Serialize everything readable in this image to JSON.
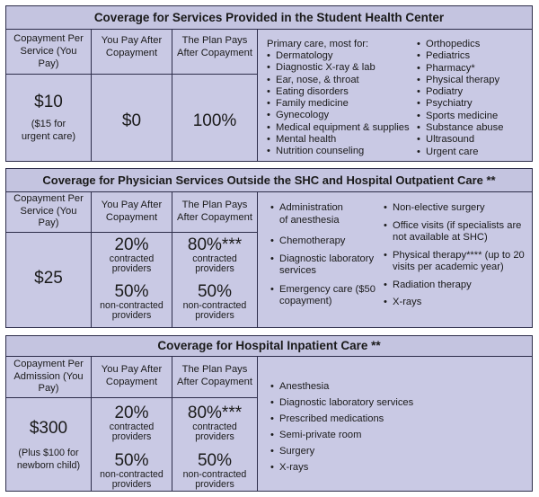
{
  "shc": {
    "title": "Coverage for Services Provided in the Student Health Center",
    "headers": [
      "Copayment Per Service (You Pay)",
      "You Pay After Copayment",
      "The Plan Pays After Copayment"
    ],
    "copay": "$10",
    "copay_note": "($15 for urgent care)",
    "you_pay": "$0",
    "plan_pays": "100%",
    "list_intro": "Primary care, most for:",
    "list_left": [
      "Dermatology",
      "Diagnostic X-ray & lab",
      "Ear, nose, & throat",
      "Eating disorders",
      "Family medicine",
      "Gynecology",
      "Medical equipment & supplies",
      "Mental health",
      "Nutrition counseling"
    ],
    "list_right": [
      "Orthopedics",
      "Pediatrics",
      "Pharmacy*",
      "Physical therapy",
      "Podiatry",
      "Psychiatry",
      "Sports medicine",
      "Substance abuse",
      "Ultrasound",
      "Urgent care"
    ]
  },
  "outpatient": {
    "title": "Coverage for Physician Services Outside the SHC and Hospital Outpatient Care **",
    "headers": [
      "Copayment Per Service (You Pay)",
      "You Pay After Copayment",
      "The Plan Pays After Copayment"
    ],
    "copay": "$25",
    "you_pay_contracted": "20%",
    "you_pay_contracted_label": "contracted providers",
    "you_pay_noncontracted": "50%",
    "you_pay_noncontracted_label": "non-contracted providers",
    "plan_contracted": "80%***",
    "plan_contracted_label": "contracted providers",
    "plan_noncontracted": "50%",
    "plan_noncontracted_label": "non-contracted providers",
    "list_left": [
      "Administration of anesthesia",
      "Chemotherapy",
      "Diagnostic laboratory services",
      "Emergency care ($50 copayment)"
    ],
    "list_right": [
      "Non-elective surgery",
      "Office visits (if specialists are not available at SHC)",
      "Physical therapy**** (up to 20 visits per academic year)",
      "Radiation therapy",
      "X-rays"
    ]
  },
  "inpatient": {
    "title": "Coverage for Hospital Inpatient Care **",
    "headers": [
      "Copayment Per Admission (You Pay)",
      "You Pay After Copayment",
      "The Plan Pays After Copayment"
    ],
    "copay": "$300",
    "copay_note": "(Plus $100 for newborn child)",
    "you_pay_contracted": "20%",
    "you_pay_contracted_label": "contracted providers",
    "you_pay_noncontracted": "50%",
    "you_pay_noncontracted_label": "non-contracted providers",
    "plan_contracted": "80%***",
    "plan_contracted_label": "contracted providers",
    "plan_noncontracted": "50%",
    "plan_noncontracted_label": "non-contracted providers",
    "list": [
      "Anesthesia",
      "Diagnostic laboratory services",
      "Prescribed medications",
      "Semi-private room",
      "Surgery",
      "X-rays"
    ]
  }
}
